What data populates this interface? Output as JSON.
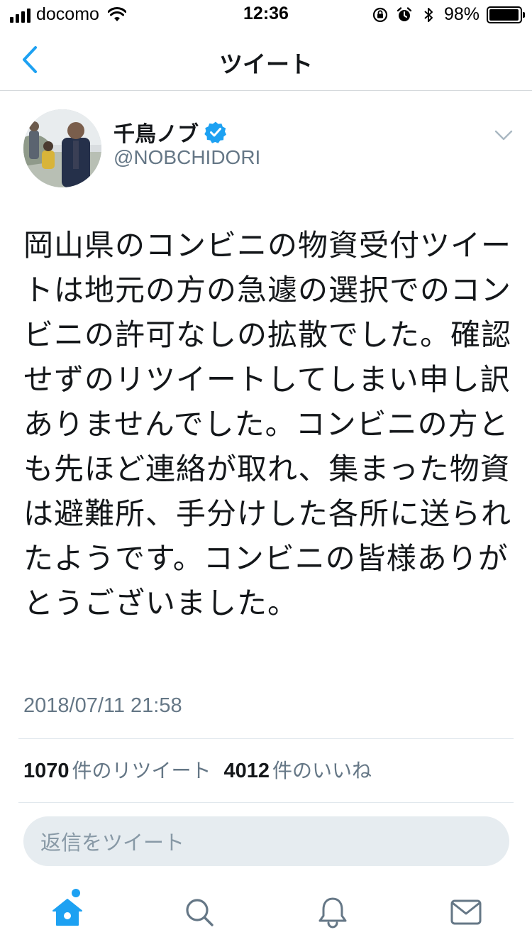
{
  "status_bar": {
    "carrier": "docomo",
    "time": "12:36",
    "battery_percent": "98%",
    "battery_level": 0.98,
    "icons": [
      "signal-icon",
      "wifi-icon",
      "rotation-lock-icon",
      "alarm-icon",
      "bluetooth-icon",
      "battery-icon"
    ]
  },
  "nav": {
    "title": "ツイート",
    "back_icon": "chevron-left-icon"
  },
  "tweet": {
    "author": {
      "name": "千鳥ノブ",
      "handle": "@NOBCHIDORI",
      "verified": true
    },
    "text": "岡山県のコンビニの物資受付ツイートは地元の方の急遽の選択でのコンビニの許可なしの拡散でした。確認せずのリツイートしてしまい申し訳ありませんでした。コンビニの方とも先ほど連絡が取れ、集まった物資は避難所、手分けした各所に送られたようです。コンビニの皆様ありがとうございました。",
    "timestamp": "2018/07/11 21:58",
    "retweets": {
      "count": "1070",
      "label": "件のリツイート"
    },
    "likes": {
      "count": "4012",
      "label": "件のいいね"
    }
  },
  "reply": {
    "placeholder": "返信をツイート"
  },
  "tab_bar": {
    "items": [
      "home-icon",
      "search-icon",
      "notifications-icon",
      "messages-icon"
    ],
    "active": "home-icon"
  },
  "colors": {
    "accent": "#1da1f2",
    "text": "#14171a",
    "secondary_text": "#657786",
    "reply_bg": "#e6ecf0",
    "icon_gray": "#657786"
  }
}
